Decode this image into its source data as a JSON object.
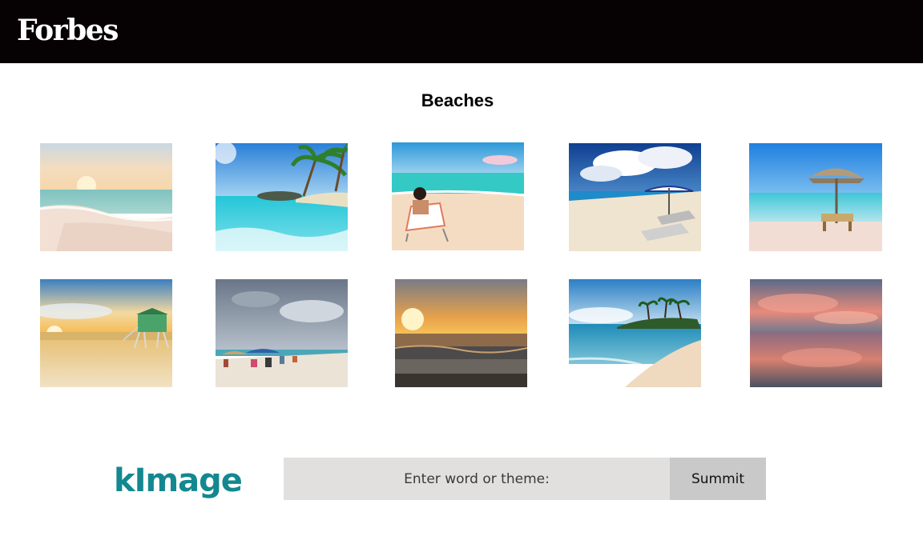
{
  "header": {
    "logo_text": "Forbes",
    "background": "#060102"
  },
  "main": {
    "title": "Beaches",
    "gallery_icon_names": [
      "beach-sunrise-waves",
      "tropical-beach-palms-rocks",
      "woman-beach-chair",
      "beach-umbrellas-loungers",
      "thatched-umbrella-chairs",
      "lifeguard-tower-sunset",
      "crowded-beach-umbrellas",
      "ocean-sunset-waves",
      "tropical-island-palms",
      "pink-sunset-reflection"
    ]
  },
  "footer": {
    "brand_text": "kImage",
    "brand_color": "#148890",
    "search_placeholder": "Enter word or theme:",
    "submit_label": "Summit"
  }
}
